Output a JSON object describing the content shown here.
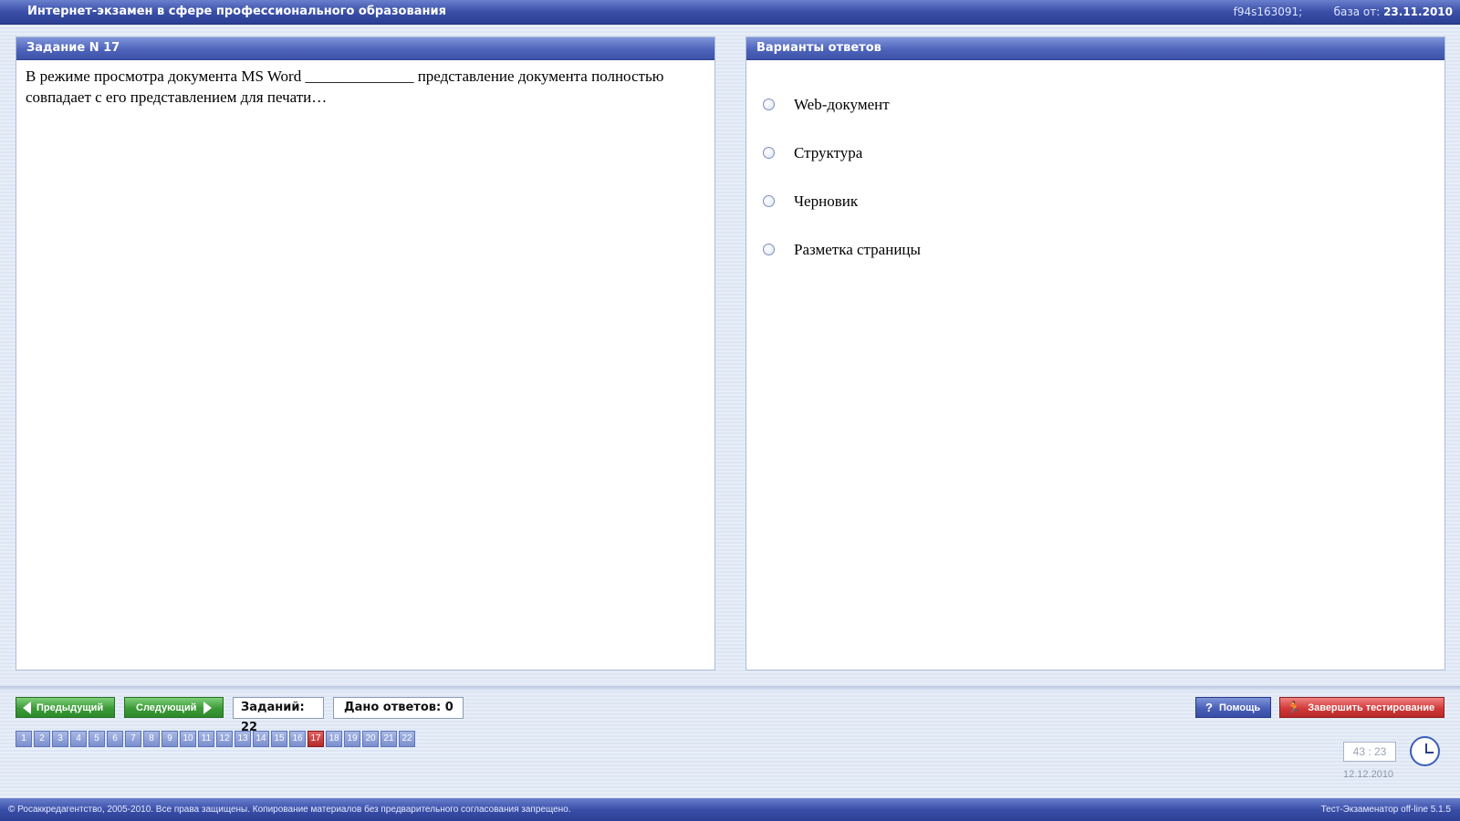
{
  "header": {
    "title": "Интернет-экзамен в сфере профессионального образования",
    "session_id": "f94s163091;",
    "base_label": "база от:",
    "base_date": "23.11.2010"
  },
  "task_panel": {
    "title": "Задание N 17",
    "question": "В режиме просмотра документа MS Word  ______________ представление документа полностью совпадает с его представлением для печати…"
  },
  "answers_panel": {
    "title": "Варианты ответов",
    "options": [
      "Web-документ",
      "Структура",
      "Черновик",
      "Разметка страницы"
    ]
  },
  "nav": {
    "prev_label": "Предыдущий",
    "next_label": "Следующий",
    "tasks_count": "Заданий: 22",
    "answers_count": "Дано ответов: 0",
    "help_label": "Помощь",
    "finish_label": "Завершить тестирование",
    "pages": [
      "1",
      "2",
      "3",
      "4",
      "5",
      "6",
      "7",
      "8",
      "9",
      "10",
      "11",
      "12",
      "13",
      "14",
      "15",
      "16",
      "17",
      "18",
      "19",
      "20",
      "21",
      "22"
    ],
    "current_page": "17"
  },
  "timer": {
    "value": "43 : 23",
    "date": "12.12.2010"
  },
  "footer": {
    "copyright": "© Росаккредагентство, 2005-2010. Все права защищены. Копирование материалов без предварительного согласования запрещено.",
    "version": "Тест-Экзаменатор off-line 5.1.5"
  },
  "colors": {
    "accent": "#3a4fa8",
    "prev_next": "#3c9a38",
    "finish": "#d23a3a",
    "current_page": "#b42a2a"
  }
}
